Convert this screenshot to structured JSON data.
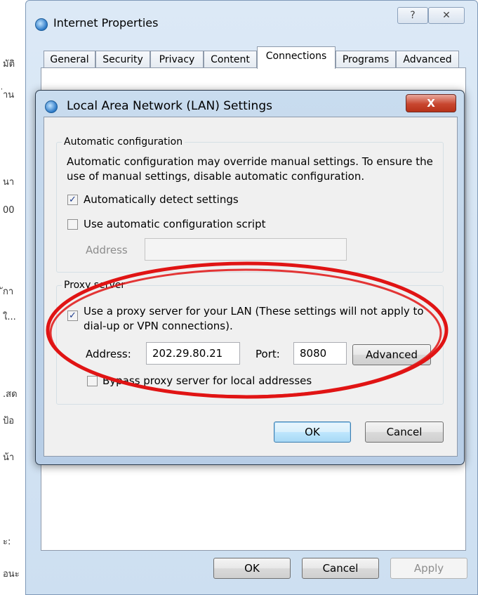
{
  "background_strip": {
    "lines": [
      "มัติ",
      "่าน",
      "นา",
      "00",
      "ักา",
      "ใ...",
      ".สด",
      "ป้อ",
      "น้า",
      "ะ:",
      "อนะ"
    ]
  },
  "outer_window": {
    "title": "Internet Properties",
    "help_label": "?",
    "close_label": "✕",
    "tabs": [
      "General",
      "Security",
      "Privacy",
      "Content",
      "Connections",
      "Programs",
      "Advanced"
    ],
    "active_tab": "Connections",
    "ok_label": "OK",
    "cancel_label": "Cancel",
    "apply_label": "Apply"
  },
  "lan_dialog": {
    "title": "Local Area Network (LAN) Settings",
    "close_label": "X",
    "auto_config": {
      "group_title": "Automatic configuration",
      "description_line1": "Automatic configuration may override manual settings.  To ensure the",
      "description_line2": "use of manual settings, disable automatic configuration.",
      "auto_detect_label": "Automatically detect settings",
      "auto_detect_checked": true,
      "use_script_label": "Use automatic configuration script",
      "use_script_checked": false,
      "address_label": "Address",
      "address_value": ""
    },
    "proxy": {
      "group_title": "Proxy server",
      "use_proxy_line1": "Use a proxy server for your LAN (These settings will not apply to",
      "use_proxy_line2": "dial-up or VPN connections).",
      "use_proxy_checked": true,
      "address_label": "Address:",
      "address_value": "202.29.80.21",
      "port_label": "Port:",
      "port_value": "8080",
      "advanced_label": "Advanced",
      "bypass_label": "Bypass proxy server for local addresses",
      "bypass_checked": false
    },
    "ok_label": "OK",
    "cancel_label": "Cancel"
  },
  "annotation": {
    "ellipse_color": "#e01414"
  }
}
